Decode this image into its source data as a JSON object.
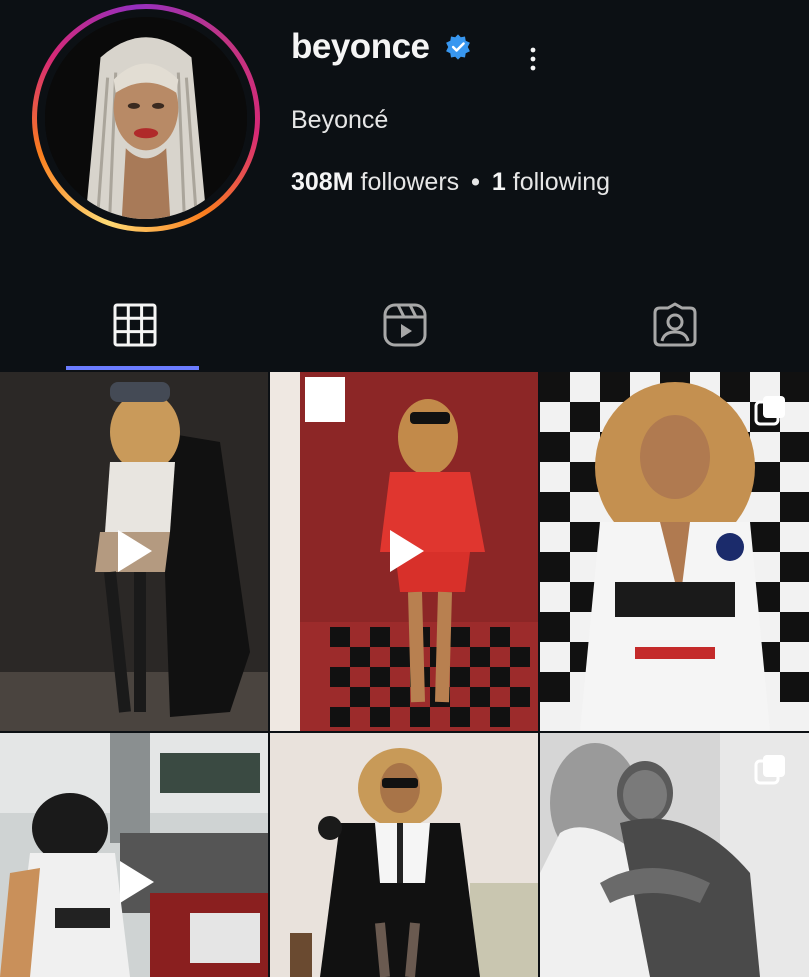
{
  "profile": {
    "username": "beyonce",
    "full_name": "Beyoncé",
    "followers_count": "308M",
    "followers_label": "followers",
    "separator": "•",
    "following_count": "1",
    "following_label": "following",
    "verified": true,
    "ring_colors": [
      "#feda75",
      "#fa7e1e",
      "#d62976",
      "#962fbf"
    ],
    "verified_color": "#3897f0"
  },
  "tabs": [
    {
      "name": "posts",
      "icon": "grid-icon",
      "active": true
    },
    {
      "name": "reels",
      "icon": "reels-icon",
      "active": false
    },
    {
      "name": "tagged",
      "icon": "tagged-icon",
      "active": false
    }
  ],
  "accent_color": "#6b7cff",
  "posts": [
    {
      "type": "reel",
      "overlay_icon": "play-icon"
    },
    {
      "type": "reel",
      "overlay_icon": "play-icon"
    },
    {
      "type": "carousel",
      "overlay_icon": "carousel-icon"
    },
    {
      "type": "reel",
      "overlay_icon": "play-icon"
    },
    {
      "type": "photo",
      "overlay_icon": ""
    },
    {
      "type": "carousel",
      "overlay_icon": "carousel-icon"
    }
  ]
}
